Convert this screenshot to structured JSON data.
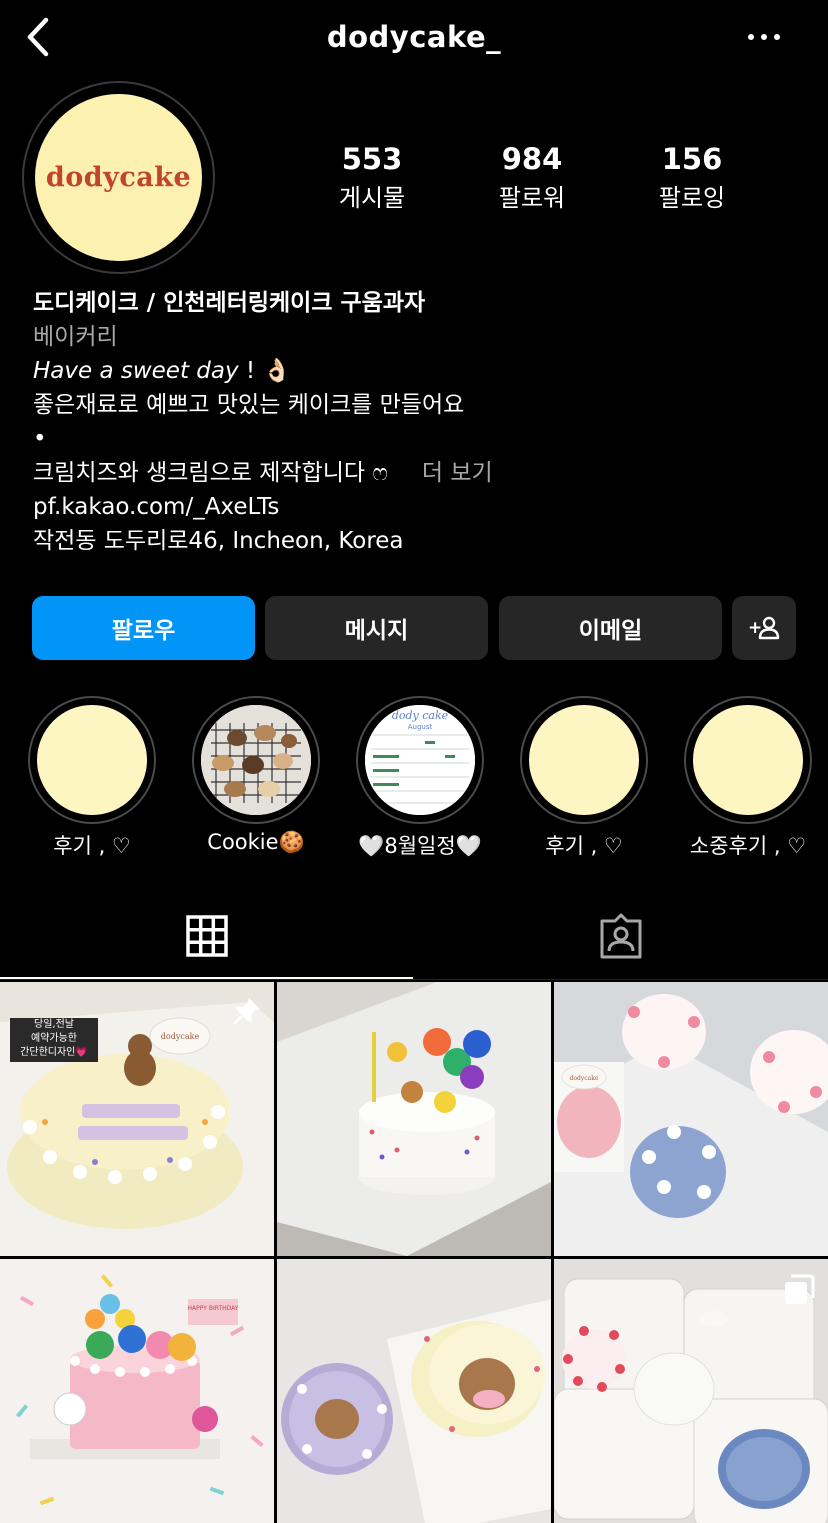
{
  "header": {
    "username": "dodycake_"
  },
  "profile": {
    "avatar_text": "dodycake",
    "stats": [
      {
        "value": "553",
        "label": "게시물"
      },
      {
        "value": "984",
        "label": "팔로워"
      },
      {
        "value": "156",
        "label": "팔로잉"
      }
    ]
  },
  "bio": {
    "name": "도디케이크 / 인천레터링케이크 구움과자",
    "category": "베이커리",
    "tagline": "Have a sweet day",
    "tagline_tail": " ! 👌🏻",
    "line1": "좋은재료로 예쁘고 맛있는 케이크를 만들어요",
    "dot": "•",
    "line2": "크림치즈와 생크림으로 제작합니다 ෆ",
    "more": "더 보기",
    "link": "pf.kakao.com/_AxeLTs",
    "address": "작전동 도두리로46, Incheon, Korea"
  },
  "actions": {
    "follow": "팔로우",
    "message": "메시지",
    "email": "이메일",
    "add_person": "+웃"
  },
  "highlights": [
    {
      "label": "후기 , ♡"
    },
    {
      "label": "Cookie🍪"
    },
    {
      "label": "🤍8월일정🤍",
      "image_text": "dody cake",
      "image_subtext": "August"
    },
    {
      "label": "후기 , ♡"
    },
    {
      "label": "소중후기 , ♡"
    }
  ],
  "posts": [
    {
      "badge": "당일,전날\n예약가능한\n간단한디자인💗",
      "box_label": "dodycake",
      "pinned": true
    },
    {},
    {
      "box_label": "dodycake"
    },
    {
      "sign": "HAPPY BIRTHDAY"
    },
    {},
    {
      "multiple": true
    }
  ],
  "colors": {
    "follow_button": "#0095f6",
    "button_bg": "#262626",
    "avatar_bg": "#fdf1b2",
    "avatar_text": "#c2442e",
    "muted": "#a8a8a8"
  }
}
